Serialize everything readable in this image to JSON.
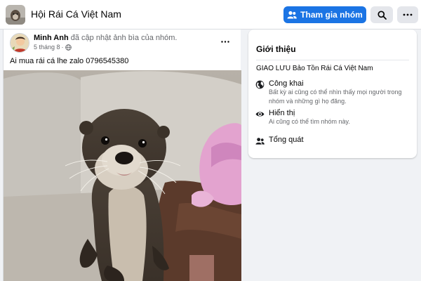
{
  "header": {
    "group_name": "Hội Rái Cá Việt Nam",
    "join_label": "Tham gia nhóm",
    "icons": [
      "group-thumbnail",
      "people-icon",
      "search-icon",
      "more-icon"
    ]
  },
  "post": {
    "author": "Minh Anh",
    "action": "đã cập nhật ảnh bìa của nhóm.",
    "date": "5 tháng 8",
    "privacy_icon": "globe-icon",
    "text": "Ai mua rái cá lhe zalo 0796545380",
    "photo": "otter-photo"
  },
  "about": {
    "title": "Giới thiệu",
    "description": "GIAO LƯU Bảo Tồn Rái Cá Việt Nam",
    "items": [
      {
        "icon": "globe-icon",
        "title": "Công khai",
        "desc": "Bất kỳ ai cũng có thể nhìn thấy mọi người trong nhóm và những gì họ đăng."
      },
      {
        "icon": "eye-icon",
        "title": "Hiển thị",
        "desc": "Ai cũng có thể tìm nhóm này."
      },
      {
        "icon": "people-icon",
        "title": "Tổng quát",
        "desc": ""
      }
    ]
  },
  "colors": {
    "accent": "#1b74e4",
    "background": "#f0f2f5",
    "secondary_text": "#65676b"
  }
}
